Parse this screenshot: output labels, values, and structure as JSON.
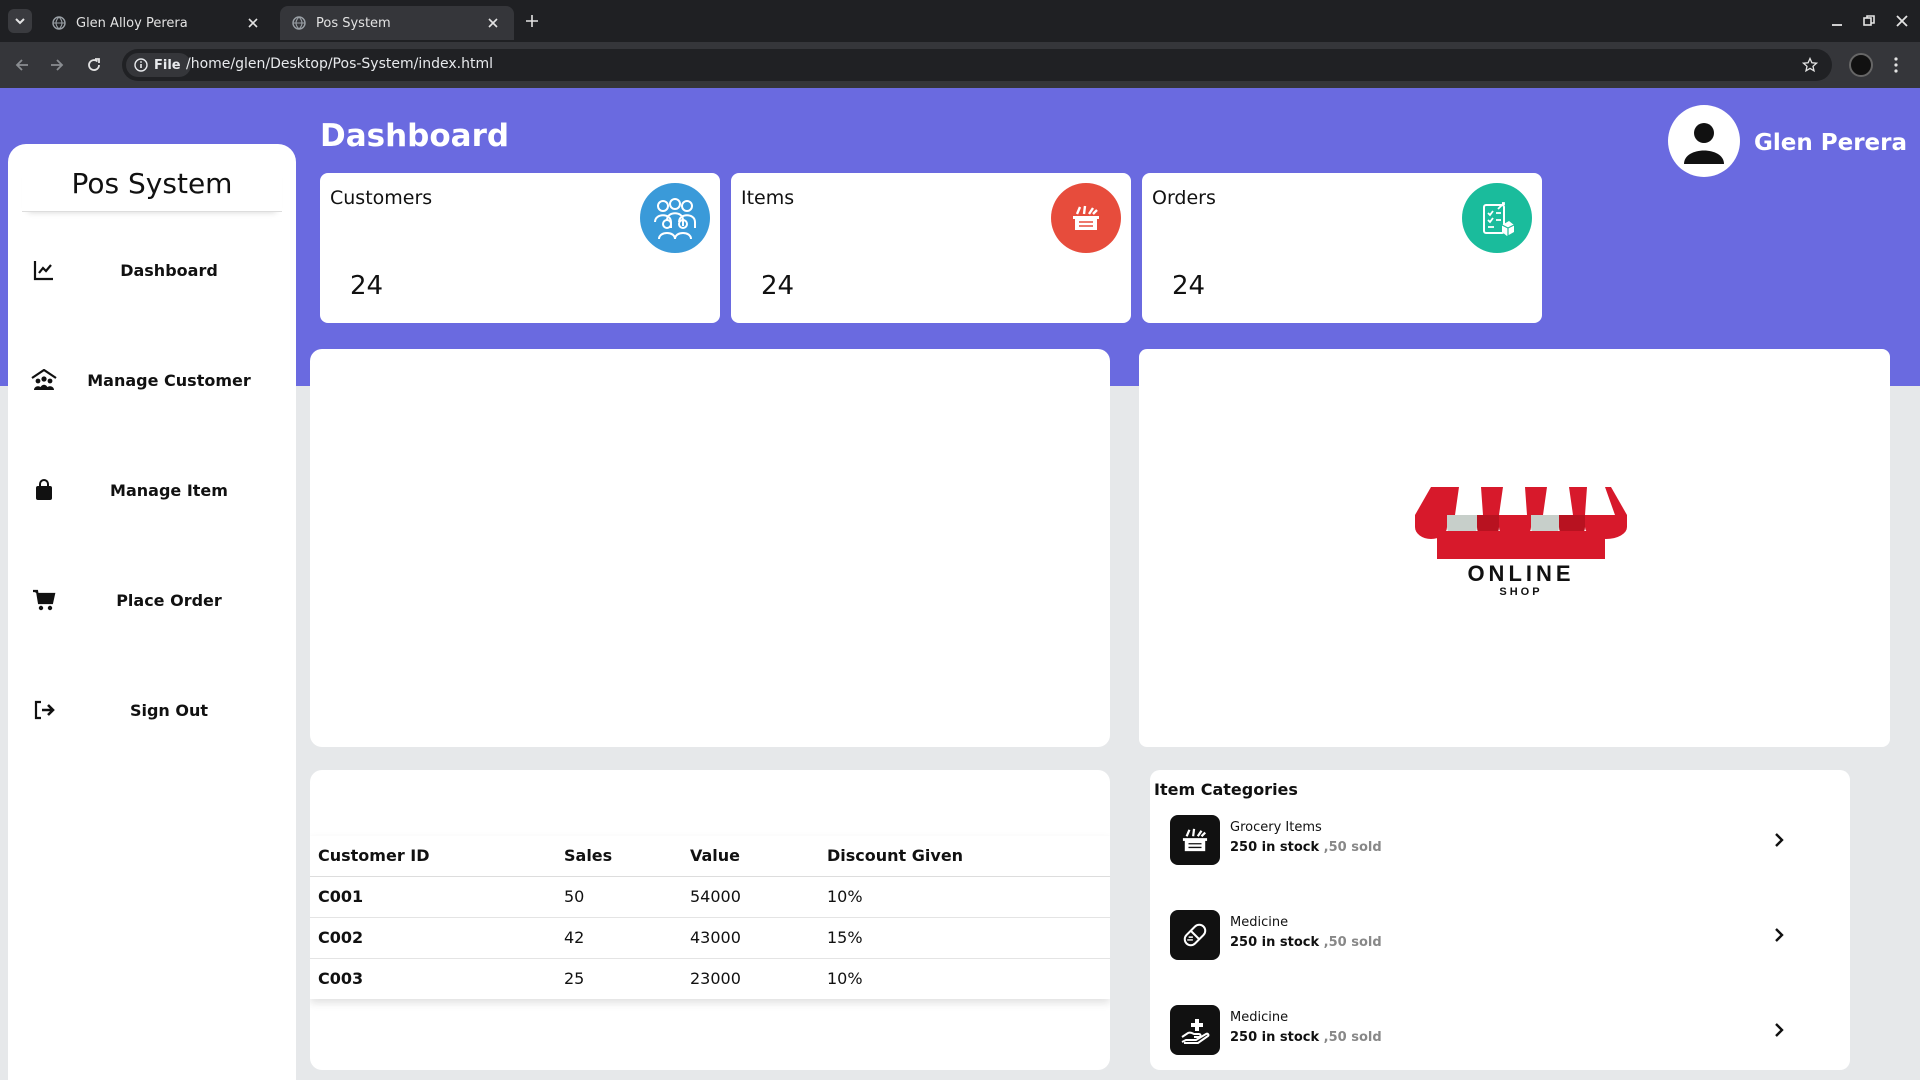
{
  "browser": {
    "tabs": [
      {
        "title": "Glen Alloy Perera",
        "active": false
      },
      {
        "title": "Pos System",
        "active": true
      }
    ],
    "address": {
      "scheme_label": "File",
      "url": "/home/glen/Desktop/Pos-System/index.html"
    }
  },
  "sidebar": {
    "brand": "Pos System",
    "items": [
      {
        "label": "Dashboard",
        "icon": "chart-line-icon"
      },
      {
        "label": "Manage Customer",
        "icon": "people-roof-icon"
      },
      {
        "label": "Manage Item",
        "icon": "shopping-bag-icon"
      },
      {
        "label": "Place Order",
        "icon": "cart-icon"
      },
      {
        "label": "Sign Out",
        "icon": "sign-out-icon"
      }
    ]
  },
  "header": {
    "title": "Dashboard",
    "user_name": "Glen Perera"
  },
  "stats": [
    {
      "title": "Customers",
      "value": "24",
      "icon": "people-group-icon",
      "color": "#3a9ad9"
    },
    {
      "title": "Items",
      "value": "24",
      "icon": "grocery-basket-icon",
      "color": "#e74c3c"
    },
    {
      "title": "Orders",
      "value": "24",
      "icon": "order-list-icon",
      "color": "#1abc9c"
    }
  ],
  "shop_logo": {
    "line1": "ONLINE",
    "line2": "SHOP"
  },
  "sales_table": {
    "headers": [
      "Customer ID",
      "Sales",
      "Value",
      "Discount Given"
    ],
    "rows": [
      [
        "C001",
        "50",
        "54000",
        "10%"
      ],
      [
        "C002",
        "42",
        "43000",
        "15%"
      ],
      [
        "C003",
        "25",
        "23000",
        "10%"
      ]
    ]
  },
  "categories": {
    "heading": "Item Categories",
    "items": [
      {
        "name": "Grocery Items",
        "stock": "250 in stock",
        "sold": ",50 sold",
        "icon": "grocery-basket-icon"
      },
      {
        "name": "Medicine",
        "stock": "250 in stock",
        "sold": ",50 sold",
        "icon": "pill-icon"
      },
      {
        "name": "Medicine",
        "stock": "250 in stock",
        "sold": ",50 sold",
        "icon": "hand-holding-medical-icon"
      }
    ]
  }
}
